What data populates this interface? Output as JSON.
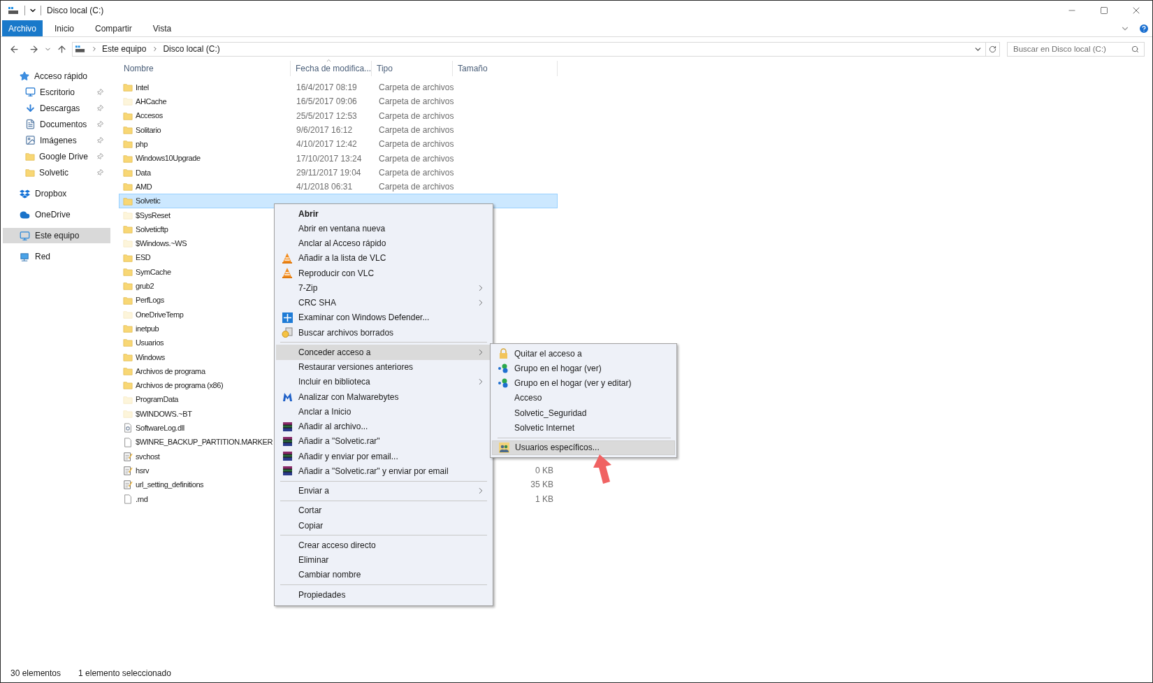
{
  "window": {
    "title": "Disco local (C:)"
  },
  "ribbon_tabs": [
    {
      "label": "Archivo",
      "selected": true
    },
    {
      "label": "Inicio",
      "selected": false
    },
    {
      "label": "Compartir",
      "selected": false
    },
    {
      "label": "Vista",
      "selected": false
    }
  ],
  "address_bar": {
    "crumbs": [
      "Este equipo",
      "Disco local (C:)"
    ]
  },
  "search": {
    "placeholder": "Buscar en Disco local (C:)"
  },
  "navigation": [
    {
      "label": "Acceso rápido",
      "kind": "quick",
      "selected": false,
      "children": [
        {
          "label": "Escritorio",
          "kind": "desktop",
          "pinned": true,
          "selected": false
        },
        {
          "label": "Descargas",
          "kind": "downloads",
          "pinned": true,
          "selected": false
        },
        {
          "label": "Documentos",
          "kind": "documents",
          "pinned": true,
          "selected": false
        },
        {
          "label": "Imágenes",
          "kind": "pictures",
          "pinned": true,
          "selected": false
        },
        {
          "label": "Google Drive",
          "kind": "folder",
          "pinned": true,
          "selected": false
        },
        {
          "label": "Solvetic",
          "kind": "folder",
          "pinned": true,
          "selected": false
        }
      ]
    },
    {
      "label": "Dropbox",
      "kind": "dropbox",
      "selected": false
    },
    {
      "label": "OneDrive",
      "kind": "onedrive",
      "selected": false
    },
    {
      "label": "Este equipo",
      "kind": "pc",
      "selected": true
    },
    {
      "label": "Red",
      "kind": "network",
      "selected": false
    }
  ],
  "table": {
    "columns": [
      {
        "label": "Nombre",
        "sorted": false
      },
      {
        "label": "Fecha de modifica...",
        "sorted": true
      },
      {
        "label": "Tipo",
        "sorted": false
      },
      {
        "label": "Tamaño",
        "sorted": false
      }
    ],
    "rows": [
      {
        "name": "Intel",
        "kind": "folder",
        "hidden": false,
        "selected": false,
        "date": "16/4/2017 08:19",
        "type": "Carpeta de archivos"
      },
      {
        "name": "AHCache",
        "kind": "folder",
        "hidden": true,
        "selected": false,
        "date": "16/5/2017 09:06",
        "type": "Carpeta de archivos"
      },
      {
        "name": "Accesos",
        "kind": "folder",
        "hidden": false,
        "selected": false,
        "date": "25/5/2017 12:53",
        "type": "Carpeta de archivos"
      },
      {
        "name": "Solitario",
        "kind": "folder",
        "hidden": false,
        "selected": false,
        "date": "9/6/2017 16:12",
        "type": "Carpeta de archivos"
      },
      {
        "name": "php",
        "kind": "folder",
        "hidden": false,
        "selected": false,
        "date": "4/10/2017 12:42",
        "type": "Carpeta de archivos"
      },
      {
        "name": "Windows10Upgrade",
        "kind": "folder",
        "hidden": false,
        "selected": false,
        "date": "17/10/2017 13:24",
        "type": "Carpeta de archivos"
      },
      {
        "name": "Data",
        "kind": "folder",
        "hidden": false,
        "selected": false,
        "date": "29/11/2017 19:04",
        "type": "Carpeta de archivos"
      },
      {
        "name": "AMD",
        "kind": "folder",
        "hidden": false,
        "selected": false,
        "date": "4/1/2018 06:31",
        "type": "Carpeta de archivos"
      },
      {
        "name": "Solvetic",
        "kind": "folder",
        "hidden": false,
        "selected": true
      },
      {
        "name": "$SysReset",
        "kind": "folder",
        "hidden": true,
        "selected": false
      },
      {
        "name": "Solveticftp",
        "kind": "folder",
        "hidden": false,
        "selected": false
      },
      {
        "name": "$Windows.~WS",
        "kind": "folder",
        "hidden": true,
        "selected": false
      },
      {
        "name": "ESD",
        "kind": "folder",
        "hidden": false,
        "selected": false
      },
      {
        "name": "SymCache",
        "kind": "folder",
        "hidden": false,
        "selected": false
      },
      {
        "name": "grub2",
        "kind": "folder",
        "hidden": false,
        "selected": false
      },
      {
        "name": "PerfLogs",
        "kind": "folder",
        "hidden": false,
        "selected": false
      },
      {
        "name": "OneDriveTemp",
        "kind": "folder",
        "hidden": true,
        "selected": false
      },
      {
        "name": "inetpub",
        "kind": "folder",
        "hidden": false,
        "selected": false
      },
      {
        "name": "Usuarios",
        "kind": "folder",
        "hidden": false,
        "selected": false
      },
      {
        "name": "Windows",
        "kind": "folder",
        "hidden": false,
        "selected": false
      },
      {
        "name": "Archivos de programa",
        "kind": "folder",
        "hidden": false,
        "selected": false
      },
      {
        "name": "Archivos de programa (x86)",
        "kind": "folder",
        "hidden": false,
        "selected": false
      },
      {
        "name": "ProgramData",
        "kind": "folder",
        "hidden": true,
        "selected": false
      },
      {
        "name": "$WINDOWS.~BT",
        "kind": "folder",
        "hidden": true,
        "selected": false
      },
      {
        "name": "SoftwareLog.dll",
        "kind": "dll",
        "hidden": false,
        "selected": false
      },
      {
        "name": "$WINRE_BACKUP_PARTITION.MARKER",
        "kind": "file",
        "hidden": false,
        "selected": false
      },
      {
        "name": "svchost",
        "kind": "script",
        "hidden": false,
        "selected": false
      },
      {
        "name": "hsrv",
        "kind": "script",
        "hidden": false,
        "selected": false,
        "size": "0 KB"
      },
      {
        "name": "url_setting_definitions",
        "kind": "script",
        "hidden": false,
        "selected": false,
        "size": "35 KB"
      },
      {
        "name": ".rnd",
        "kind": "file",
        "hidden": false,
        "selected": false,
        "size": "1 KB"
      }
    ]
  },
  "context_menu": {
    "items": [
      {
        "kind": "default",
        "label": "Abrir",
        "selected": false,
        "submenu": false
      },
      {
        "kind": "item",
        "label": "Abrir en ventana nueva",
        "selected": false,
        "submenu": false
      },
      {
        "kind": "item",
        "label": "Anclar al Acceso rápido",
        "selected": false,
        "submenu": false
      },
      {
        "kind": "item",
        "label": "Añadir a la lista de VLC",
        "selected": false,
        "submenu": false
      },
      {
        "kind": "item",
        "label": "Reproducir con VLC",
        "selected": false,
        "submenu": false
      },
      {
        "kind": "item",
        "label": "7-Zip",
        "selected": false,
        "submenu": true
      },
      {
        "kind": "item",
        "label": "CRC SHA",
        "selected": false,
        "submenu": true
      },
      {
        "kind": "item",
        "label": "Examinar con Windows Defender...",
        "selected": false,
        "submenu": false
      },
      {
        "kind": "item",
        "label": "Buscar archivos borrados",
        "selected": false,
        "submenu": false
      },
      {
        "kind": "separator"
      },
      {
        "kind": "item",
        "label": "Conceder acceso a",
        "selected": true,
        "submenu": true
      },
      {
        "kind": "item",
        "label": "Restaurar versiones anteriores",
        "selected": false,
        "submenu": false
      },
      {
        "kind": "item",
        "label": "Incluir en biblioteca",
        "selected": false,
        "submenu": true
      },
      {
        "kind": "item",
        "label": "Analizar con Malwarebytes",
        "selected": false,
        "submenu": false
      },
      {
        "kind": "item",
        "label": "Anclar a Inicio",
        "selected": false,
        "submenu": false
      },
      {
        "kind": "item",
        "label": "Añadir al archivo...",
        "selected": false,
        "submenu": false
      },
      {
        "kind": "item",
        "label": "Añadir a \"Solvetic.rar\"",
        "selected": false,
        "submenu": false
      },
      {
        "kind": "item",
        "label": "Añadir y enviar por email...",
        "selected": false,
        "submenu": false
      },
      {
        "kind": "item",
        "label": "Añadir a \"Solvetic.rar\" y enviar por email",
        "selected": false,
        "submenu": false
      },
      {
        "kind": "separator"
      },
      {
        "kind": "item",
        "label": "Enviar a",
        "selected": false,
        "submenu": true
      },
      {
        "kind": "separator"
      },
      {
        "kind": "item",
        "label": "Cortar",
        "selected": false,
        "submenu": false
      },
      {
        "kind": "item",
        "label": "Copiar",
        "selected": false,
        "submenu": false
      },
      {
        "kind": "separator"
      },
      {
        "kind": "item",
        "label": "Crear acceso directo",
        "selected": false,
        "submenu": false
      },
      {
        "kind": "item",
        "label": "Eliminar",
        "selected": false,
        "submenu": false
      },
      {
        "kind": "item",
        "label": "Cambiar nombre",
        "selected": false,
        "submenu": false
      },
      {
        "kind": "separator"
      },
      {
        "kind": "item",
        "label": "Propiedades",
        "selected": false,
        "submenu": false
      }
    ]
  },
  "submenu": {
    "items": [
      {
        "kind": "item",
        "label": "Quitar el acceso a",
        "selected": false
      },
      {
        "kind": "item",
        "label": "Grupo en el hogar (ver)",
        "selected": false
      },
      {
        "kind": "item",
        "label": "Grupo en el hogar (ver y editar)",
        "selected": false
      },
      {
        "kind": "item",
        "label": "Acceso",
        "selected": false
      },
      {
        "kind": "item",
        "label": "Solvetic_Seguridad",
        "selected": false
      },
      {
        "kind": "item",
        "label": "Solvetic Internet",
        "selected": false
      },
      {
        "kind": "separator"
      },
      {
        "kind": "item",
        "label": "Usuarios específicos...",
        "selected": true
      }
    ]
  },
  "status_bar": {
    "count": "30 elementos",
    "selection": "1 elemento seleccionado"
  }
}
